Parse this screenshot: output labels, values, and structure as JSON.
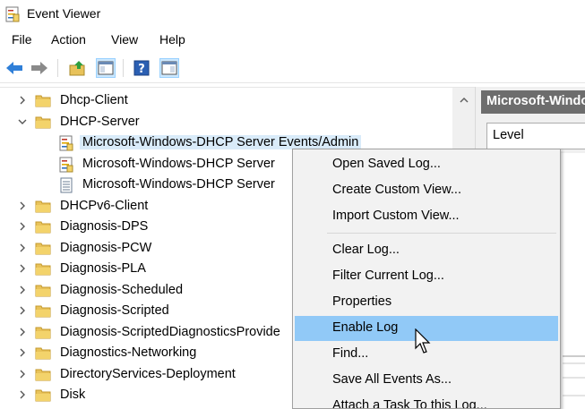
{
  "window": {
    "title": "Event Viewer"
  },
  "menubar": {
    "items": [
      "File",
      "Action",
      "View",
      "Help"
    ]
  },
  "toolbar": {
    "buttons": [
      "back-icon",
      "forward-icon",
      "up-folder-icon",
      "show-hide-console-tree-icon",
      "help-icon",
      "show-hide-action-pane-icon"
    ]
  },
  "tree": {
    "rows": [
      {
        "label": "Dhcp-Client",
        "type": "folder",
        "expanded": false
      },
      {
        "label": "DHCP-Server",
        "type": "folder",
        "expanded": true
      },
      {
        "label": "Microsoft-Windows-DHCP Server Events/Admin",
        "type": "log",
        "selected": true
      },
      {
        "label": "Microsoft-Windows-DHCP Server",
        "type": "log"
      },
      {
        "label": "Microsoft-Windows-DHCP Server",
        "type": "log-disabled"
      },
      {
        "label": "DHCPv6-Client",
        "type": "folder",
        "expanded": false
      },
      {
        "label": "Diagnosis-DPS",
        "type": "folder",
        "expanded": false
      },
      {
        "label": "Diagnosis-PCW",
        "type": "folder",
        "expanded": false
      },
      {
        "label": "Diagnosis-PLA",
        "type": "folder",
        "expanded": false
      },
      {
        "label": "Diagnosis-Scheduled",
        "type": "folder",
        "expanded": false
      },
      {
        "label": "Diagnosis-Scripted",
        "type": "folder",
        "expanded": false
      },
      {
        "label": "Diagnosis-ScriptedDiagnosticsProvide",
        "type": "folder",
        "expanded": false
      },
      {
        "label": "Diagnostics-Networking",
        "type": "folder",
        "expanded": false
      },
      {
        "label": "DirectoryServices-Deployment",
        "type": "folder",
        "expanded": false
      },
      {
        "label": "Disk",
        "type": "folder",
        "expanded": false
      }
    ]
  },
  "right_pane": {
    "header": "Microsoft-Windo",
    "column": "Level"
  },
  "context_menu": {
    "items": [
      "Open Saved Log...",
      "Create Custom View...",
      "Import Custom View...",
      "Clear Log...",
      "Filter Current Log...",
      "Properties",
      "Enable Log",
      "Find...",
      "Save All Events As...",
      "Attach a Task To this Log..."
    ],
    "highlighted": "Enable Log"
  },
  "colors": {
    "menu_highlight": "#91c9f7",
    "selection": "#d9ebf9",
    "folder": "#e8c25a",
    "header": "#6d6d6d"
  }
}
